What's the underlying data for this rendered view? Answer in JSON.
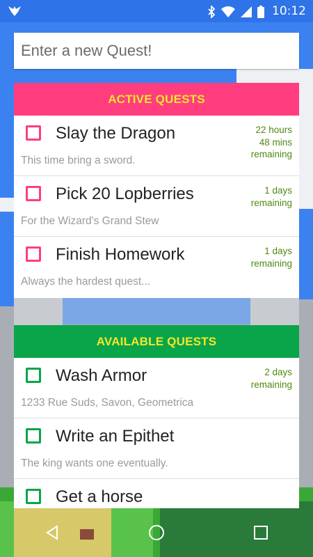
{
  "status_bar": {
    "time": "10:12",
    "icons": [
      "app-bird-icon",
      "bluetooth-icon",
      "wifi-icon",
      "signal-icon",
      "battery-icon"
    ]
  },
  "quest_input": {
    "placeholder": "Enter a new Quest!",
    "value": ""
  },
  "active": {
    "header": "ACTIVE QUESTS",
    "color": "#ff3d7f",
    "quests": [
      {
        "title": "Slay the Dragon",
        "desc": "This time bring a sword.",
        "time": [
          "22 hours",
          "48 mins",
          "remaining"
        ]
      },
      {
        "title": "Pick 20 Lopberries",
        "desc": "For the Wizard's Grand Stew",
        "time": [
          "1 days",
          "remaining"
        ]
      },
      {
        "title": "Finish Homework",
        "desc": "Always the hardest quest...",
        "time": [
          "1 days",
          "remaining"
        ]
      }
    ]
  },
  "available": {
    "header": "AVAILABLE QUESTS",
    "color": "#0aa54a",
    "quests": [
      {
        "title": "Wash Armor",
        "desc": "1233 Rue Suds, Savon, Geometrica",
        "time": [
          "2 days",
          "remaining"
        ]
      },
      {
        "title": "Write an Epithet",
        "desc": "The king wants one eventually.",
        "time": []
      },
      {
        "title": "Get a horse",
        "desc": "",
        "time": []
      }
    ]
  },
  "colors": {
    "header_text": "#f5e62a",
    "time_text": "#4f8a10",
    "sky": "#3b82f0"
  },
  "nav": [
    "back-icon",
    "home-icon",
    "recents-icon"
  ]
}
